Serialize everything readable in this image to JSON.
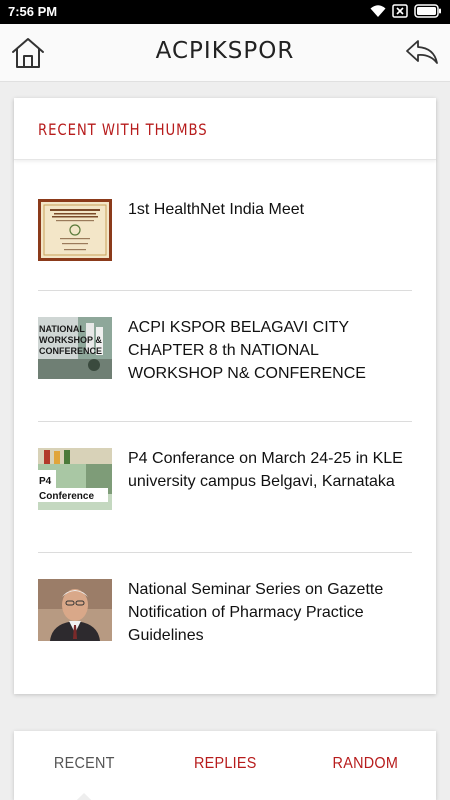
{
  "status_bar": {
    "time": "7:56 PM",
    "icons": [
      "wifi-icon",
      "sim-x-icon",
      "battery-icon"
    ]
  },
  "app_bar": {
    "title": "ACPIKSPOR",
    "left_icon": "home-icon",
    "right_icon": "reply-back-icon"
  },
  "card": {
    "title": "RECENT WITH THUMBS",
    "posts": [
      {
        "title": "1st HealthNet India Meet",
        "thumb": "invitation-card-thumbnail"
      },
      {
        "title": "ACPI KSPOR BELAGAVI CITY CHAPTER 8 th NATIONAL WORKSHOP N& CONFERENCE",
        "thumb": "workshop-conference-thumbnail",
        "thumb_text": [
          "NATIONAL",
          "WORKSHOP &",
          "CONFERENCE"
        ]
      },
      {
        "title": "P4 Conferance on March 24-25 in KLE university campus Belgavi, Karnataka",
        "thumb": "p4-conference-thumbnail",
        "thumb_text": [
          "P4",
          "Conference"
        ]
      },
      {
        "title": "National Seminar Series on Gazette Notification of Pharmacy Practice Guidelines",
        "thumb": "portrait-thumbnail"
      }
    ]
  },
  "tabs": [
    {
      "label": "RECENT",
      "active": true
    },
    {
      "label": "REPLIES",
      "active": false
    },
    {
      "label": "RANDOM",
      "active": false
    }
  ],
  "colors": {
    "accent": "#b71c1c",
    "status_bar": "#000000",
    "background": "#eeeeee"
  }
}
